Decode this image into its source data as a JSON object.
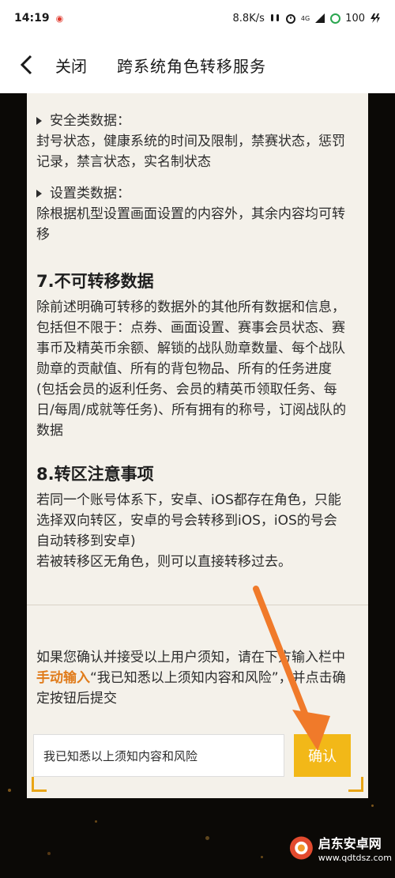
{
  "status_bar": {
    "time": "14:19",
    "network_speed": "8.8K/s",
    "signal_label": "4G",
    "battery": "100"
  },
  "nav": {
    "close_label": "关闭",
    "title": "跨系统角色转移服务"
  },
  "content": {
    "safety_head": "安全类数据：",
    "safety_body": "封号状态，健康系统的时间及限制，禁赛状态，惩罚记录，禁言状态，实名制状态",
    "settings_head": "设置类数据：",
    "settings_body": "除根据机型设置画面设置的内容外，其余内容均可转移",
    "section7_title": "7.不可转移数据",
    "section7_body": "除前述明确可转移的数据外的其他所有数据和信息，包括但不限于：点券、画面设置、赛事会员状态、赛事币及精英币余额、解锁的战队勋章数量、每个战队勋章的贡献值、所有的背包物品、所有的任务进度(包括会员的返利任务、会员的精英币领取任务、每日/每周/成就等任务)、所有拥有的称号，订阅战队的数据",
    "section8_title": "8.转区注意事项",
    "section8_body_1": "若同一个账号体系下，安卓、iOS都存在角色，只能选择双向转区，安卓的号会转移到iOS，iOS的号会自动转移到安卓)",
    "section8_body_2": "若被转移区无角色，则可以直接转移过去。",
    "notice_pre": "如果您确认并接受以上用户须知，请在下方输入栏中",
    "notice_highlight": "手动输入",
    "notice_post": "“我已知悉以上须知内容和风险”，并点击确定按钮后提交"
  },
  "form": {
    "input_value": "我已知悉以上须知内容和风险",
    "confirm_label": "确认"
  },
  "watermark": {
    "name": "启东安卓网",
    "url": "www.qdtdsz.com"
  },
  "colors": {
    "accent": "#f2b818",
    "highlight": "#e07b1a",
    "arrow": "#f07a2a",
    "panel": "#f4f1ea"
  }
}
